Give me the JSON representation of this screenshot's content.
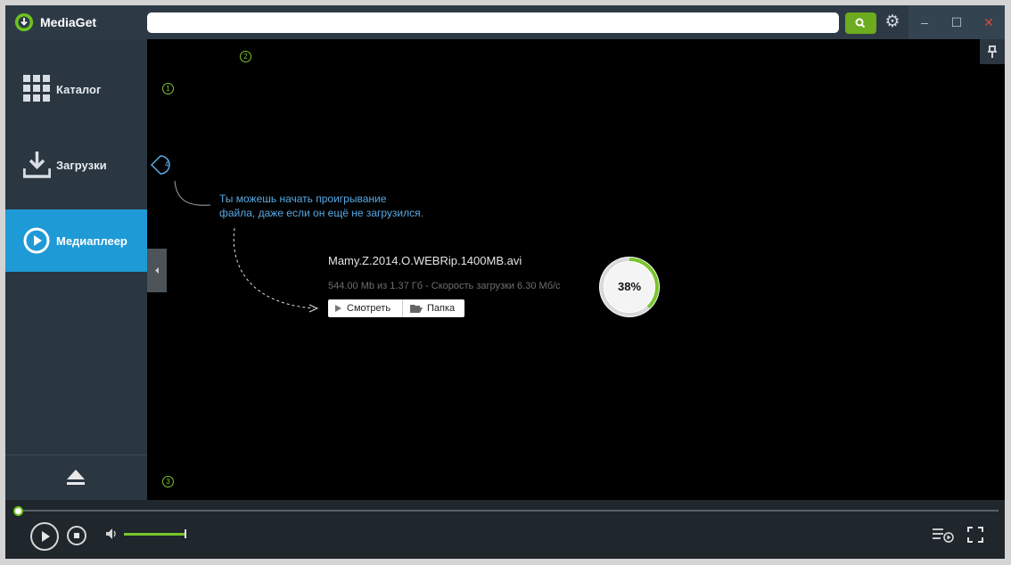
{
  "app": {
    "title": "MediaGet"
  },
  "search": {
    "placeholder": ""
  },
  "sidebar": {
    "items": [
      {
        "label": "Каталог",
        "icon": "grid-icon"
      },
      {
        "label": "Загрузки",
        "icon": "download-icon"
      },
      {
        "label": "Медиаплеер",
        "icon": "play-circle-icon",
        "active": true
      }
    ]
  },
  "tour": {
    "steps": [
      "1",
      "2",
      "3",
      "4"
    ],
    "hint": [
      "Ты можешь начать проигрывание",
      "файла, даже если он ещё не загрузился."
    ]
  },
  "download": {
    "filename": "Mamy.Z.2014.O.WEBRip.1400MB.avi",
    "info": "544.00 Mb из 1.37 Гб - Скорость загрузки 6.30 Мб/с",
    "watch_label": "Смотреть",
    "folder_label": "Папка",
    "progress_label": "38%",
    "progress": 0.38
  },
  "player": {
    "seek_position": 0,
    "volume": 0.95
  },
  "colors": {
    "accent_green": "#6dab1f",
    "active_blue": "#1e9ad6",
    "hint_blue": "#58a9e4"
  }
}
